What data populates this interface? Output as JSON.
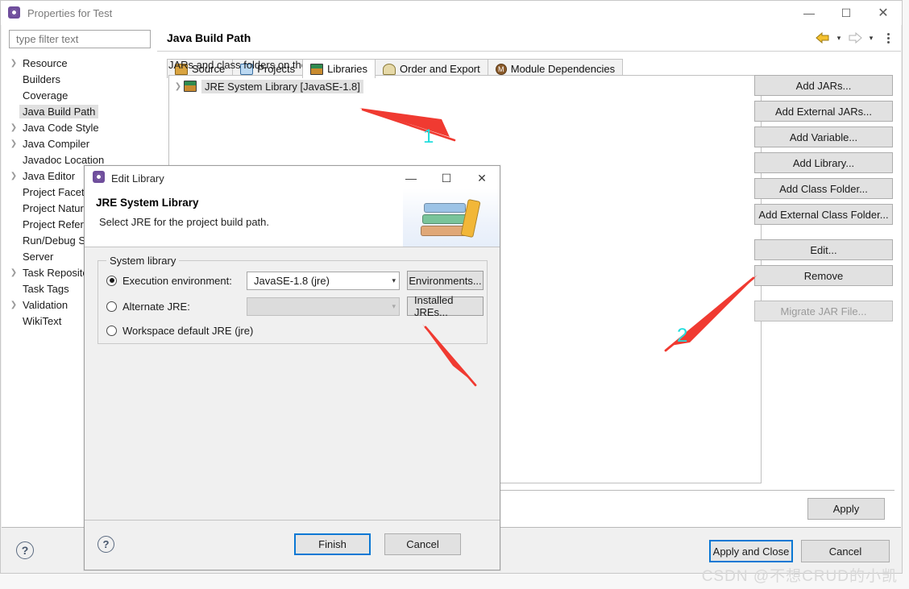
{
  "window": {
    "title": "Properties for Test",
    "icon": "eclipse-icon",
    "minimize": "—",
    "maximize": "☐",
    "close": "✕"
  },
  "sidebar": {
    "filter_placeholder": "type filter text",
    "filter_value": "",
    "items": [
      {
        "label": "Resource",
        "expandable": true,
        "selected": false
      },
      {
        "label": "Builders",
        "expandable": false,
        "selected": false
      },
      {
        "label": "Coverage",
        "expandable": false,
        "selected": false
      },
      {
        "label": "Java Build Path",
        "expandable": false,
        "selected": true
      },
      {
        "label": "Java Code Style",
        "expandable": true,
        "selected": false
      },
      {
        "label": "Java Compiler",
        "expandable": true,
        "selected": false
      },
      {
        "label": "Javadoc Location",
        "expandable": false,
        "selected": false
      },
      {
        "label": "Java Editor",
        "expandable": true,
        "selected": false
      },
      {
        "label": "Project Facets",
        "expandable": false,
        "selected": false
      },
      {
        "label": "Project Natures",
        "expandable": false,
        "selected": false
      },
      {
        "label": "Project References",
        "expandable": false,
        "selected": false
      },
      {
        "label": "Run/Debug Settings",
        "expandable": false,
        "selected": false
      },
      {
        "label": "Server",
        "expandable": false,
        "selected": false
      },
      {
        "label": "Task Repositories",
        "expandable": true,
        "selected": false
      },
      {
        "label": "Task Tags",
        "expandable": false,
        "selected": false
      },
      {
        "label": "Validation",
        "expandable": true,
        "selected": false
      },
      {
        "label": "WikiText",
        "expandable": false,
        "selected": false
      }
    ]
  },
  "main": {
    "title": "Java Build Path",
    "nav": {
      "back_icon": "arrow-left-icon",
      "back_caret": "▾",
      "forward_icon": "arrow-right-icon",
      "forward_caret": "▾",
      "menu_icon": "kebab-menu-icon"
    },
    "tabs": [
      {
        "label": "Source",
        "icon": "source-folder-icon",
        "active": false
      },
      {
        "label": "Projects",
        "icon": "projects-folder-icon",
        "active": false
      },
      {
        "label": "Libraries",
        "icon": "libraries-icon",
        "active": true
      },
      {
        "label": "Order and Export",
        "icon": "order-export-icon",
        "active": false
      },
      {
        "label": "Module Dependencies",
        "icon": "module-icon",
        "active": false
      }
    ],
    "list_label": "JARs and class folders on the build path:",
    "list_items": [
      {
        "label": "JRE System Library [JavaSE-1.8]",
        "icon": "libraries-icon",
        "expandable": true,
        "selected": true
      }
    ],
    "buttons": [
      {
        "label": "Add JARs...",
        "disabled": false,
        "gap_after": false
      },
      {
        "label": "Add External JARs...",
        "disabled": false,
        "gap_after": false
      },
      {
        "label": "Add Variable...",
        "disabled": false,
        "gap_after": false
      },
      {
        "label": "Add Library...",
        "disabled": false,
        "gap_after": false
      },
      {
        "label": "Add Class Folder...",
        "disabled": false,
        "gap_after": false
      },
      {
        "label": "Add External Class Folder...",
        "disabled": false,
        "gap_after": true
      },
      {
        "label": "Edit...",
        "disabled": false,
        "gap_after": false
      },
      {
        "label": "Remove",
        "disabled": false,
        "gap_after": true
      },
      {
        "label": "Migrate JAR File...",
        "disabled": true,
        "gap_after": false
      }
    ],
    "apply_label": "Apply"
  },
  "footer": {
    "help_icon": "help-icon",
    "help_glyph": "?",
    "apply_and_close": "Apply and Close",
    "cancel": "Cancel"
  },
  "modal": {
    "title": "Edit Library",
    "icon": "eclipse-icon",
    "minimize": "—",
    "maximize": "☐",
    "close": "✕",
    "heading": "JRE System Library",
    "subheading": "Select JRE for the project build path.",
    "banner_icon": "books-stack-icon",
    "group_legend": "System library",
    "options": [
      {
        "label": "Execution environment:",
        "selected": true,
        "combo_value": "JavaSE-1.8 (jre)",
        "combo_disabled": false,
        "button": "Environments..."
      },
      {
        "label": "Alternate JRE:",
        "selected": false,
        "combo_value": "",
        "combo_disabled": true,
        "button": "Installed JREs..."
      },
      {
        "label": "Workspace default JRE (jre)",
        "selected": false,
        "combo_value": null,
        "combo_disabled": null,
        "button": null
      }
    ],
    "help_glyph": "?",
    "finish": "Finish",
    "cancel": "Cancel"
  },
  "annotations": {
    "arrow_color": "#f03a31",
    "number_color": "#22dddd",
    "markers": [
      {
        "number": "1"
      },
      {
        "number": "2"
      }
    ]
  },
  "watermark": {
    "text": "CSDN @不想CRUD的小凯"
  }
}
